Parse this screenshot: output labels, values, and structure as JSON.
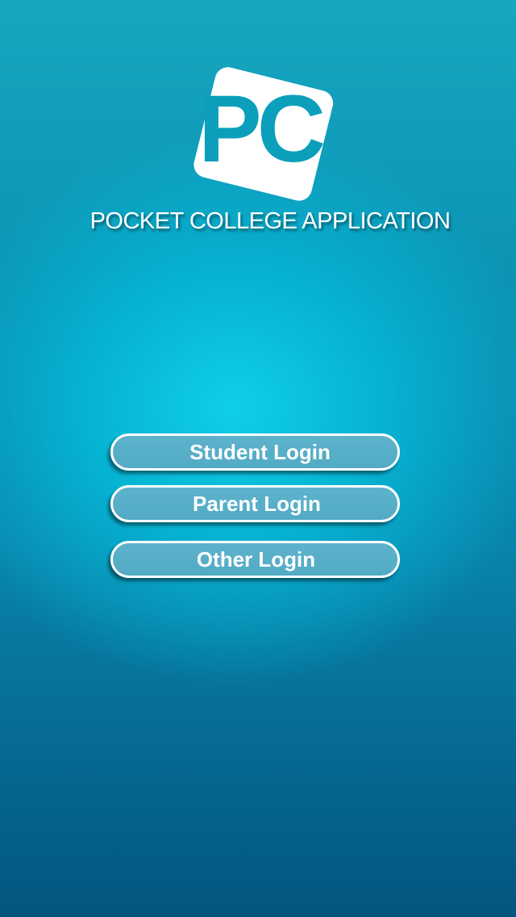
{
  "logo": {
    "text": "PC",
    "icon": "pc-logo-icon",
    "text_color": "#0b9fbc",
    "tile_color": "#ffffff"
  },
  "app_title": "POCKET COLLEGE APPLICATION",
  "buttons": {
    "student": "Student Login",
    "parent": "Parent Login",
    "other": "Other Login"
  },
  "colors": {
    "background_center": "#10cfe6",
    "background_edge": "#04557f",
    "button_fill": "#56aec6",
    "button_border": "#ffffff"
  }
}
